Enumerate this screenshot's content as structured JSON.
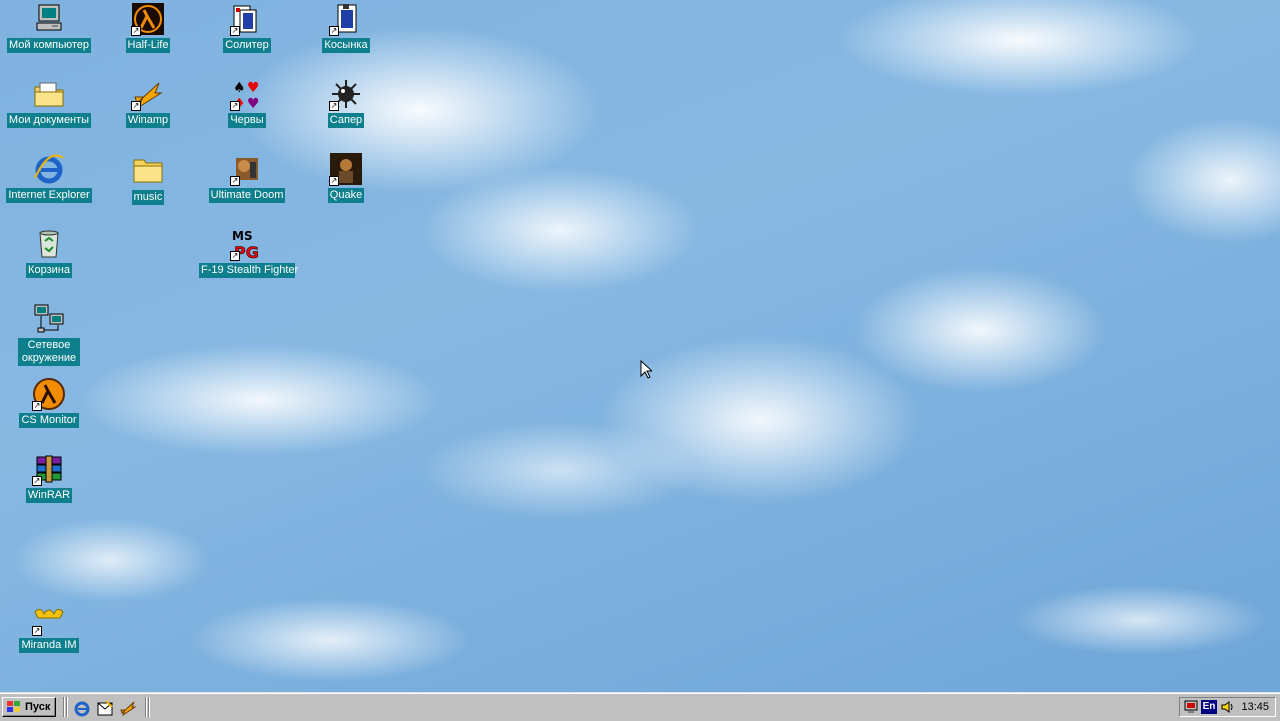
{
  "desktop": {
    "icons": [
      {
        "label": "Мой компьютер",
        "icon": "my-computer-icon"
      },
      {
        "label": "Мои документы",
        "icon": "my-documents-icon"
      },
      {
        "label": "Internet Explorer",
        "icon": "internet-explorer-icon"
      },
      {
        "label": "Корзина",
        "icon": "recycle-bin-icon"
      },
      {
        "label": "Сетевое окружение",
        "icon": "network-neighborhood-icon"
      },
      {
        "label": "CS Monitor",
        "icon": "half-life-lambda-icon"
      },
      {
        "label": "WinRAR",
        "icon": "winrar-icon"
      },
      {
        "label": "Miranda IM",
        "icon": "miranda-icon"
      },
      {
        "label": "Half-Life",
        "icon": "half-life-lambda-icon"
      },
      {
        "label": "Winamp",
        "icon": "winamp-icon"
      },
      {
        "label": "music",
        "icon": "folder-icon"
      },
      {
        "label": "Солитер",
        "icon": "solitaire-icon"
      },
      {
        "label": "Червы",
        "icon": "hearts-icon"
      },
      {
        "label": "Ultimate Doom",
        "icon": "doom-icon"
      },
      {
        "label": "F-19 Stealth Fighter",
        "icon": "f19-icon"
      },
      {
        "label": "Косынка",
        "icon": "solitaire-card-icon"
      },
      {
        "label": "Сапер",
        "icon": "minesweeper-icon"
      },
      {
        "label": "Quake",
        "icon": "quake-icon"
      }
    ]
  },
  "taskbar": {
    "start_label": "Пуск",
    "quick_launch": [
      "internet-explorer-icon",
      "outlook-express-icon",
      "winamp-icon"
    ],
    "tray": {
      "language": "En",
      "clock": "13:45",
      "icons": [
        "display-settings-icon",
        "volume-icon"
      ]
    }
  },
  "colors": {
    "label_bg": "#0e7f8c",
    "taskbar": "#c0c0c0"
  }
}
